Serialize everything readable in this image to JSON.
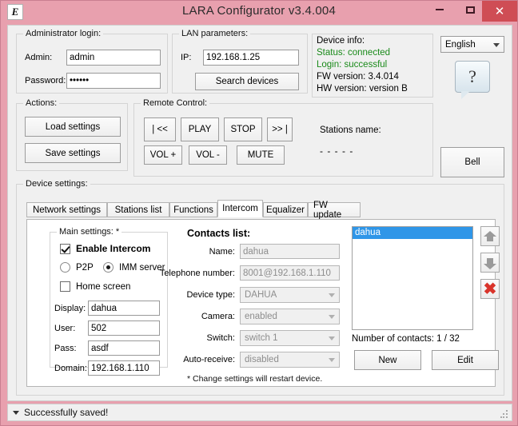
{
  "window": {
    "title": "LARA Configurator v3.4.004",
    "icon": "app-icon-E",
    "minimize_label": "Minimize",
    "maximize_label": "Maximize",
    "close_label": "✕"
  },
  "admin_login": {
    "legend": "Administrator login:",
    "admin_label": "Admin:",
    "admin_value": "admin",
    "password_label": "Password:",
    "password_value": "••••••"
  },
  "lan": {
    "legend": "LAN parameters:",
    "ip_label": "IP:",
    "ip_value": "192.168.1.25",
    "search_button": "Search devices"
  },
  "device_info": {
    "legend": "Device info:",
    "status": "Status: connected",
    "login": "Login: successful",
    "fw": "FW version: 3.4.014",
    "hw": "HW version: version B",
    "status_color": "#1a8a1a"
  },
  "language": {
    "selected": "English",
    "help_glyph": "?"
  },
  "actions": {
    "legend": "Actions:",
    "load_settings": "Load settings",
    "save_settings": "Save settings"
  },
  "remote_control": {
    "legend": "Remote Control:",
    "prev": "| <<",
    "play": "PLAY",
    "stop": "STOP",
    "next": ">> |",
    "vol_up": "VOL +",
    "vol_down": "VOL -",
    "mute": "MUTE",
    "stations_label": "Stations name:",
    "stations_value": "- - - - -"
  },
  "bell_button": "Bell",
  "device_settings": {
    "legend": "Device settings:",
    "tabs": [
      {
        "label": "Network settings",
        "active": false
      },
      {
        "label": "Stations list",
        "active": false
      },
      {
        "label": "Functions",
        "active": false
      },
      {
        "label": "Intercom",
        "active": true
      },
      {
        "label": "Equalizer",
        "active": false
      },
      {
        "label": "FW update",
        "active": false
      }
    ]
  },
  "main_settings": {
    "legend": "Main settings: *",
    "enable_intercom_label": "Enable Intercom",
    "enable_intercom_checked": true,
    "p2p_label": "P2P",
    "p2p_selected": false,
    "imm_label": "IMM server",
    "imm_selected": true,
    "home_screen_label": "Home screen",
    "home_screen_checked": false,
    "display_label": "Display:",
    "display_value": "dahua",
    "user_label": "User:",
    "user_value": "502",
    "pass_label": "Pass:",
    "pass_value": "asdf",
    "domain_label": "Domain:",
    "domain_value": "192.168.1.110"
  },
  "contacts": {
    "title": "Contacts list:",
    "name_label": "Name:",
    "name_value": "dahua",
    "phone_label": "Telephone number:",
    "phone_value": "8001@192.168.1.110",
    "device_type_label": "Device type:",
    "device_type_value": "DAHUA",
    "camera_label": "Camera:",
    "camera_value": "enabled",
    "switch_label": "Switch:",
    "switch_value": "switch 1",
    "auto_receive_label": "Auto-receive:",
    "auto_receive_value": "disabled",
    "footnote": "* Change settings will restart device.",
    "items": [
      {
        "label": "dahua",
        "selected": true
      }
    ],
    "count_text": "Number of contacts: 1 / 32",
    "move_up_icon": "arrow-up-icon",
    "move_down_icon": "arrow-down-icon",
    "delete_icon": "red-x-icon",
    "new_button": "New",
    "edit_button": "Edit"
  },
  "statusbar": {
    "message": "Successfully saved!"
  },
  "colors": {
    "titlebar": "#e8a0ae",
    "close": "#cf4d55",
    "selection": "#2f96e8",
    "success": "#1a8a1a",
    "delete": "#d9342b"
  }
}
